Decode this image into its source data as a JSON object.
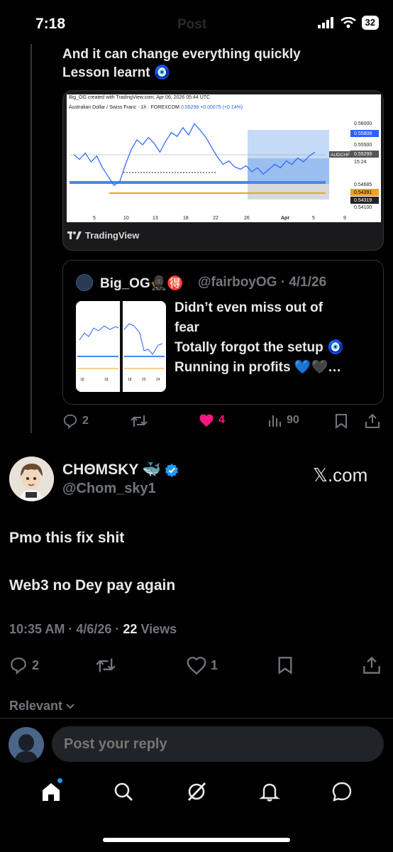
{
  "status": {
    "time": "7:18",
    "title": "Post",
    "battery": "32"
  },
  "reply": {
    "line1": "And it can change everything quickly",
    "line2": "Lesson learnt 🧿"
  },
  "chart": {
    "caption": "Big_OG created with TradingView.com, Apr 06, 2026 05:44 UTC",
    "title_pair": "Australian Dollar / Swiss Franc · 1h · FOREXCOM",
    "title_price": "0.55299",
    "title_change": "+0.00079 (+0.14%)",
    "brand": "TradingView",
    "symbol_tag": "AUDCHF",
    "countdown": "15:24"
  },
  "chart_data": {
    "type": "line",
    "title": "Australian Dollar / Swiss Franc · 1h · FOREXCOM",
    "x_tick_labels": [
      "5",
      "10",
      "13",
      "18",
      "22",
      "26",
      "Apr",
      "5",
      "9"
    ],
    "y_tick_labels": [
      "0.56000",
      "0.55808",
      "0.55500",
      "0.55299",
      "0.54685",
      "0.54391",
      "0.54319",
      "0.54100"
    ],
    "ylim": [
      0.541,
      0.561
    ],
    "series": [
      {
        "values": [
          0.5525,
          0.5515,
          0.5528,
          0.551,
          0.5522,
          0.5498,
          0.548,
          0.5462,
          0.547,
          0.5505,
          0.5535,
          0.5555,
          0.5545,
          0.556,
          0.5548,
          0.553,
          0.5552,
          0.557,
          0.5562,
          0.558,
          0.5565,
          0.5588,
          0.5575,
          0.556,
          0.554,
          0.552,
          0.5505,
          0.5512,
          0.55,
          0.5495,
          0.5502,
          0.549,
          0.5498,
          0.5485,
          0.5495,
          0.5505,
          0.5498,
          0.5512,
          0.5505,
          0.5518,
          0.551,
          0.5522,
          0.553
        ]
      }
    ]
  },
  "quote": {
    "name": "Big_OG🥷🏿🉐",
    "handle": "@fairboyOG · 4/1/26",
    "text1": "Didn’t even miss out of",
    "text2": "fear",
    "text3": "Totally forgot the setup 🧿",
    "text4": "Running in profits 💙🖤…",
    "thumb_ticks_left": [
      "18",
      "18"
    ],
    "thumb_ticks_right": [
      "18",
      "20",
      "24"
    ]
  },
  "reply_actions": {
    "replies": "2",
    "likes": "4",
    "views": "90"
  },
  "tweet": {
    "name": "CHΘMSKY 🐳",
    "handle": "@Chom_sky1",
    "site": "𝕏.com",
    "line1": "Pmo this fix shit",
    "line2": "Web3 no Dey pay again",
    "meta_time": "10:35 AM · 4/6/26 · ",
    "meta_views": "22",
    "meta_views_label": " Views"
  },
  "tweet_actions": {
    "replies": "2",
    "likes": "1"
  },
  "relevant_label": "Relevant",
  "reply_input": {
    "placeholder": "Post your reply"
  },
  "colors": {
    "accent": "#1d9bf0",
    "like": "#f91880",
    "muted": "#71767b",
    "text": "#e7e9ea"
  }
}
